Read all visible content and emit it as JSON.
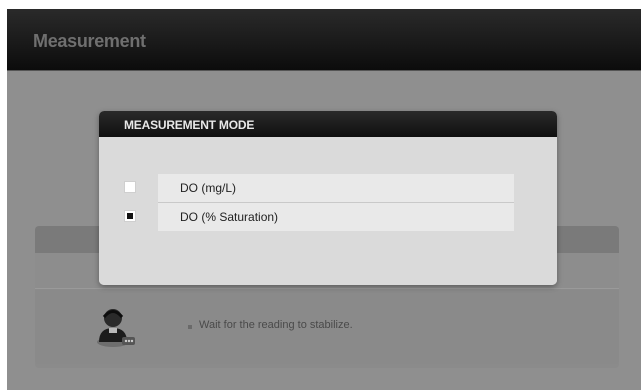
{
  "app": {
    "title": "Measurement"
  },
  "dialog": {
    "title": "MEASUREMENT MODE",
    "options": [
      {
        "label": "DO (mg/L)",
        "selected": false
      },
      {
        "label": "DO (% Saturation)",
        "selected": true
      }
    ]
  },
  "background": {
    "info_text": "Wait for the reading to stabilize.",
    "avatar_icon": "user-headset-icon"
  },
  "colors": {
    "titlebar": "#1a1a1a",
    "dialog_header": "#111111",
    "dialog_body": "#dadada",
    "screen_bg": "#8f8f8f"
  }
}
